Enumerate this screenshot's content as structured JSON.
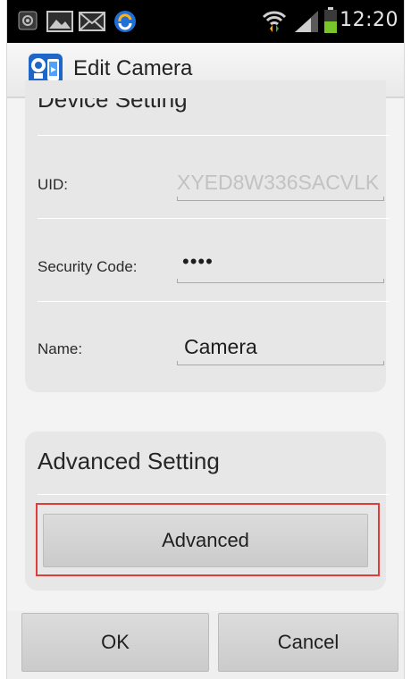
{
  "status_bar": {
    "time": "12:20",
    "icons": [
      "notification-icon",
      "gallery-icon",
      "email-icon",
      "sync-icon",
      "wifi-icon",
      "signal-icon",
      "battery-icon"
    ]
  },
  "title_bar": {
    "title": "Edit Camera",
    "app_icon": "camera-app-icon"
  },
  "device_setting": {
    "title": "Device Setting",
    "uid": {
      "label": "UID:",
      "value": "XYED8W336SACVLK"
    },
    "security_code": {
      "label": "Security Code:",
      "value": "••••"
    },
    "name": {
      "label": "Name:",
      "value": "Camera"
    }
  },
  "advanced_setting": {
    "title": "Advanced Setting",
    "button_label": "Advanced",
    "highlight_color": "#e53a3a"
  },
  "buttons": {
    "ok_label": "OK",
    "cancel_label": "Cancel"
  }
}
